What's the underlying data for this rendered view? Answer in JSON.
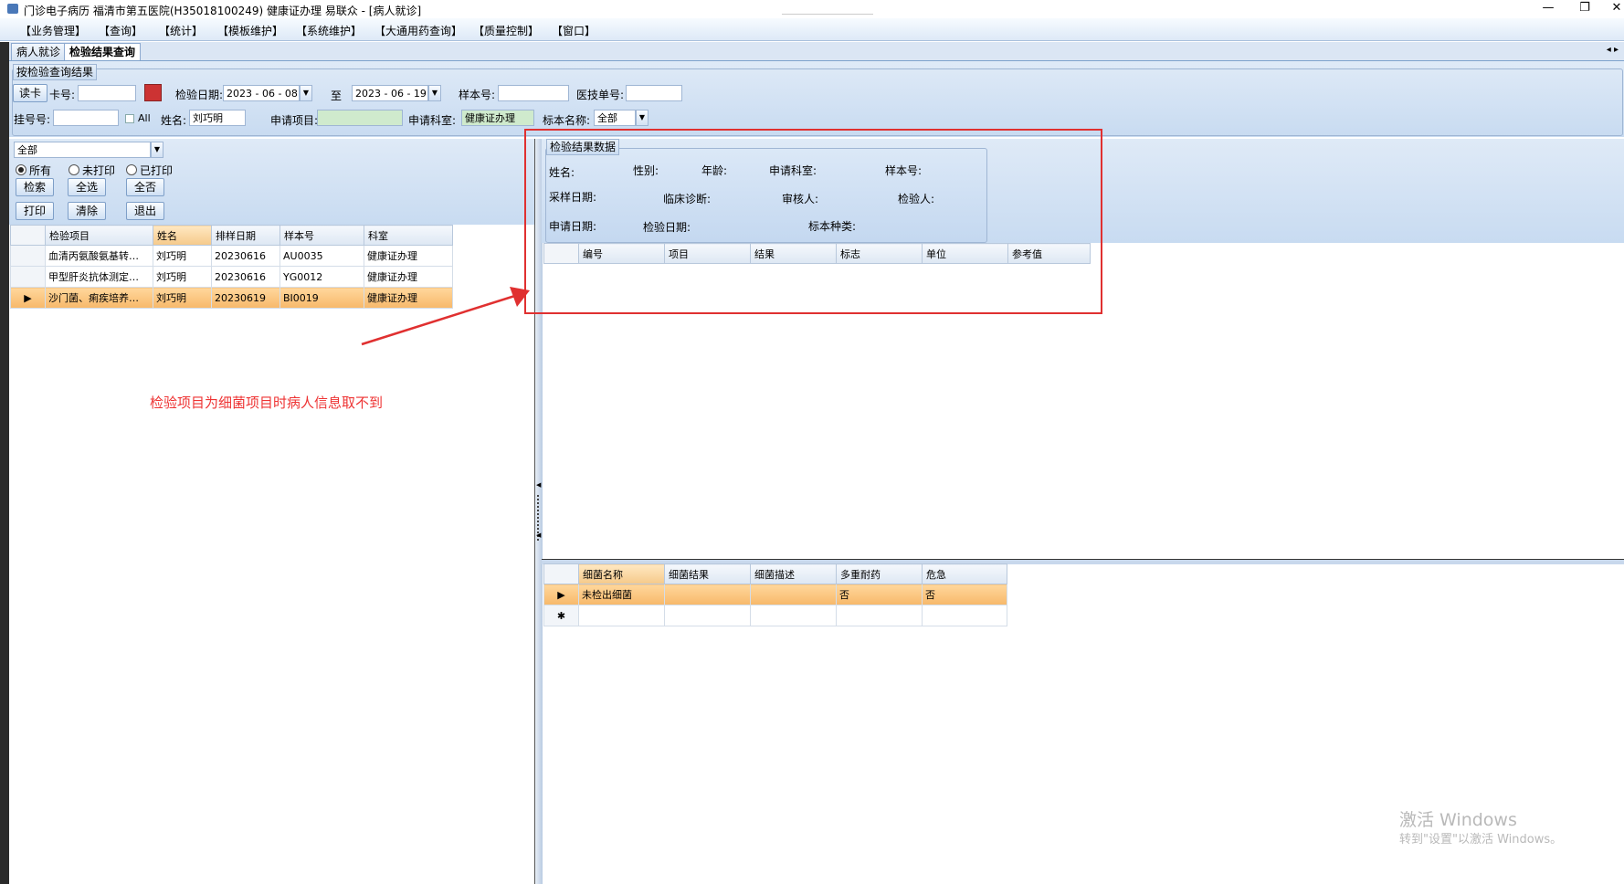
{
  "window": {
    "title": "门诊电子病历  福清市第五医院(H35018100249)  健康证办理  易联众 - [病人就诊]",
    "minimize": "—",
    "restore": "❐",
    "close": "✕"
  },
  "menu": [
    "【业务管理】",
    "【查询】",
    "【统计】",
    "【模板维护】",
    "【系统维护】",
    "【大通用药查询】",
    "【质量控制】",
    "【窗口】"
  ],
  "tabs": [
    {
      "label": "病人就诊",
      "active": false
    },
    {
      "label": "检验结果查询",
      "active": true
    }
  ],
  "tab_nav": "◂ ▸",
  "filter": {
    "group_title": "按检验查询结果",
    "read_card_button": "读卡",
    "card_label": "卡号:",
    "card_value": "",
    "date_label": "检验日期:",
    "date_from": "2023 - 06 - 08",
    "to_label": "至",
    "date_to": "2023 - 06 - 19",
    "sample_label": "样本号:",
    "sample_value": "",
    "insurance_label": "医技单号:",
    "insurance_value": "",
    "reg_label": "挂号号:",
    "reg_value": "",
    "all_checkbox_label": "All",
    "name_label": "姓名:",
    "name_value": "刘巧明",
    "apply_item_label": "申请项目:",
    "apply_item_value": "",
    "apply_dept_label": "申请科室:",
    "apply_dept_value": "健康证办理",
    "specimen_label": "标本名称:",
    "specimen_value": "全部"
  },
  "left": {
    "status_select": "全部",
    "radios": [
      {
        "label": "所有",
        "checked": true
      },
      {
        "label": "未打印",
        "checked": false
      },
      {
        "label": "已打印",
        "checked": false
      }
    ],
    "buttons": {
      "search": "检索",
      "select_all": "全选",
      "select_none": "全否",
      "print": "打印",
      "clear": "清除",
      "exit": "退出"
    },
    "columns": [
      "检验项目",
      "姓名",
      "排样日期",
      "样本号",
      "科室"
    ],
    "rows": [
      {
        "item": "血清丙氨酸氨基转…",
        "name": "刘巧明",
        "date": "20230616",
        "sample": "AU0035",
        "dept": "健康证办理",
        "selected": false
      },
      {
        "item": "甲型肝炎抗体测定…",
        "name": "刘巧明",
        "date": "20230616",
        "sample": "YG0012",
        "dept": "健康证办理",
        "selected": false
      },
      {
        "item": "沙门菌、痢疾培养…",
        "name": "刘巧明",
        "date": "20230619",
        "sample": "BI0019",
        "dept": "健康证办理",
        "selected": true
      }
    ]
  },
  "result": {
    "group_title": "检验结果数据",
    "fields": {
      "name": "姓名:",
      "gender": "性别:",
      "age": "年龄:",
      "dept": "申请科室:",
      "sample_no": "样本号:",
      "collect_date": "采样日期:",
      "diagnosis": "临床诊断:",
      "reviewer": "审核人:",
      "tester": "检验人:",
      "apply_date": "申请日期:",
      "test_date": "检验日期:",
      "specimen_type": "标本种类:"
    },
    "columns": [
      "编号",
      "项目",
      "结果",
      "标志",
      "单位",
      "参考值"
    ]
  },
  "bacteria": {
    "columns": [
      "细菌名称",
      "细菌结果",
      "细菌描述",
      "多重耐药",
      "危急"
    ],
    "rows": [
      {
        "name": "未检出细菌",
        "result": "",
        "desc": "",
        "mdr": "否",
        "critical": "否"
      }
    ],
    "new_row_marker": "✱"
  },
  "annotation": "检验项目为细菌项目时病人信息取不到",
  "watermark": {
    "line1": "激活 Windows",
    "line2": "转到\"设置\"以激活 Windows。"
  }
}
